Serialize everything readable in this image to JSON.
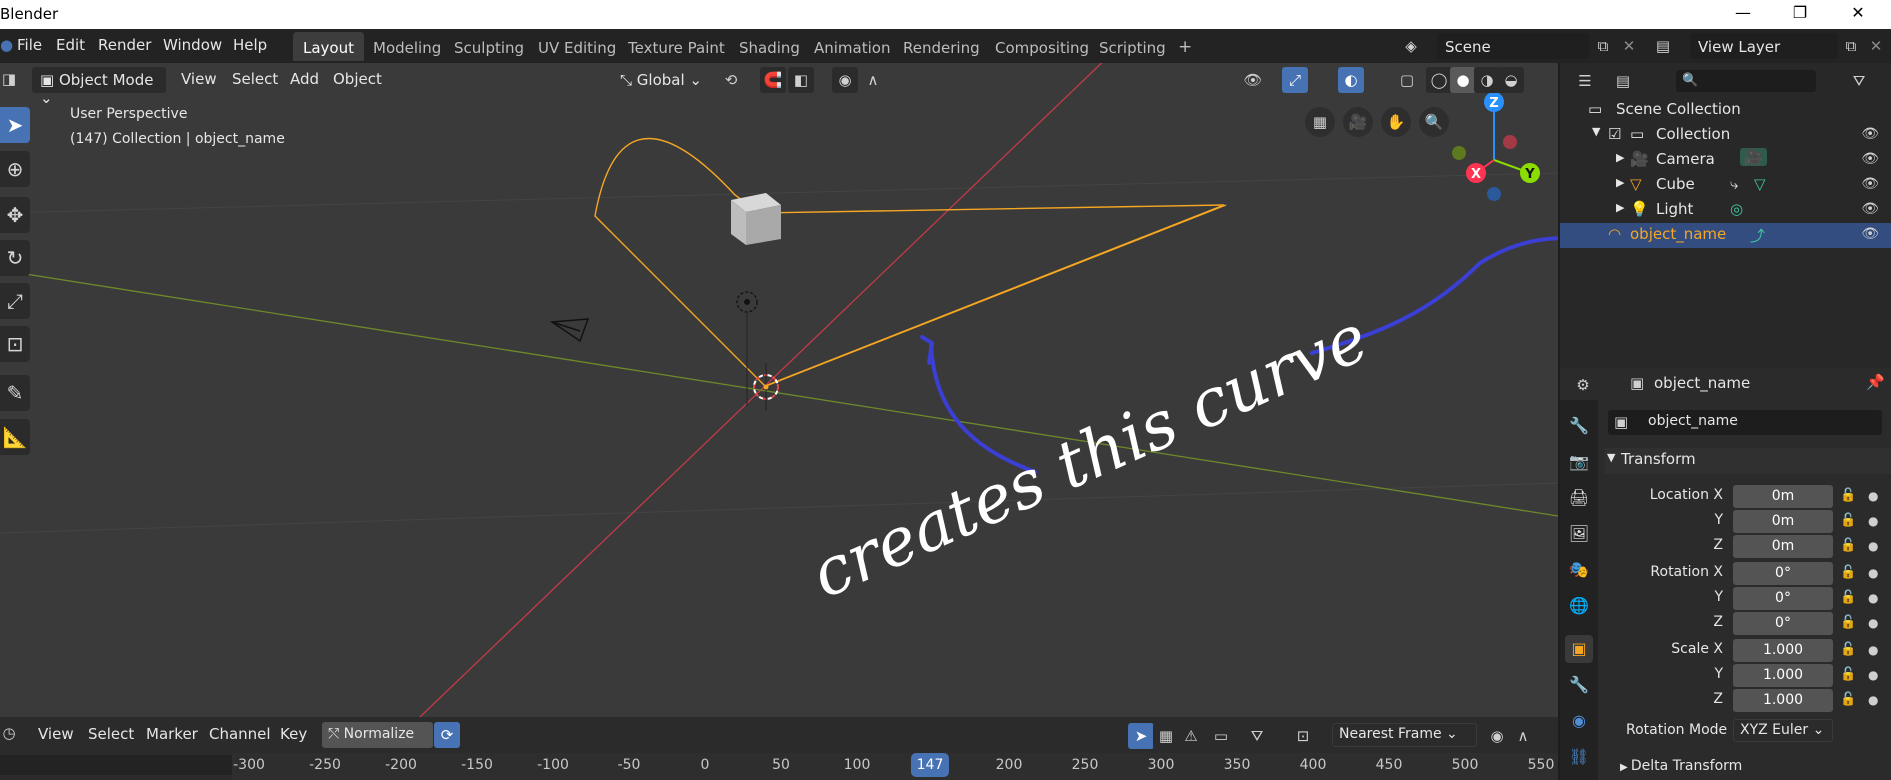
{
  "window": {
    "title": "Blender",
    "controls": [
      "—",
      "❐",
      "✕"
    ]
  },
  "menus": [
    "File",
    "Edit",
    "Render",
    "Window",
    "Help"
  ],
  "workspaces": [
    "Layout",
    "Modeling",
    "Sculpting",
    "UV Editing",
    "Texture Paint",
    "Shading",
    "Animation",
    "Rendering",
    "Compositing",
    "Scripting"
  ],
  "workspace_add": "+",
  "scene": {
    "name": "Scene",
    "view_layer": "View Layer"
  },
  "viewport": {
    "mode": "Object Mode",
    "menus": [
      "View",
      "Select",
      "Add",
      "Object"
    ],
    "orientation": "Global",
    "perspective_label": "User Perspective",
    "context_label": "(147) Collection | object_name",
    "gizmo": {
      "z": "Z",
      "x": "X",
      "y": "Y"
    }
  },
  "annotation": {
    "text": "creates this curve",
    "color": "#3b3fd4"
  },
  "outliner": {
    "search_placeholder": "",
    "rows": [
      {
        "label": "Scene Collection",
        "icon": "collection-icon"
      },
      {
        "label": "Collection",
        "icon": "collection-icon"
      },
      {
        "label": "Camera",
        "icon": "camera-icon"
      },
      {
        "label": "Cube",
        "icon": "mesh-icon"
      },
      {
        "label": "Light",
        "icon": "light-icon"
      },
      {
        "label": "object_name",
        "icon": "curve-icon",
        "selected": true
      }
    ]
  },
  "properties": {
    "header_object": "object_name",
    "object_name_field": "object_name",
    "transform_title": "Transform",
    "location": {
      "label": "Location X",
      "x": "0m",
      "y": "0m",
      "z": "0m"
    },
    "rotation": {
      "label": "Rotation X",
      "x": "0°",
      "y": "0°",
      "z": "0°"
    },
    "scale": {
      "label": "Scale X",
      "x": "1.000",
      "y": "1.000",
      "z": "1.000"
    },
    "axis_y": "Y",
    "axis_z": "Z",
    "rotation_mode_label": "Rotation Mode",
    "rotation_mode_value": "XYZ Euler",
    "delta_transform": "Delta Transform"
  },
  "timeline": {
    "menus": [
      "View",
      "Select",
      "Marker",
      "Channel",
      "Key"
    ],
    "normalize": "Normalize",
    "snap": "Nearest Frame",
    "current_frame": "147",
    "ticks": [
      "-300",
      "-250",
      "-200",
      "-150",
      "-100",
      "-50",
      "0",
      "50",
      "100",
      "150",
      "200",
      "250",
      "300",
      "350",
      "400",
      "450",
      "500",
      "550"
    ]
  },
  "colors": {
    "accent": "#4772b3",
    "selection": "#f5a623",
    "curve": "#f5a623",
    "x_axis": "#ff3352",
    "y_axis": "#8bdc00",
    "z_axis": "#2890ff"
  }
}
